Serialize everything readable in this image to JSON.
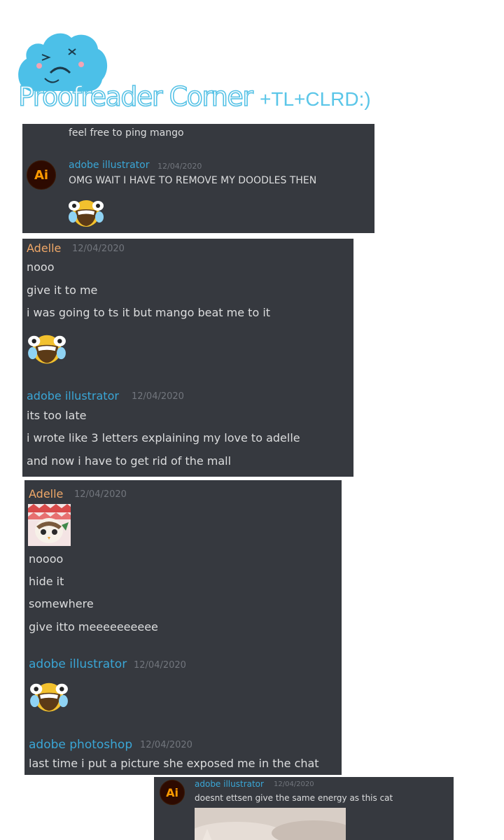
{
  "header": {
    "title": "Proofreader Corner",
    "tag": "+TL+CLRD:)"
  },
  "panel1": {
    "prev_message": "feel free to ping mango",
    "avatar_text": "Ai",
    "author": "adobe illustrator",
    "timestamp": "12/04/2020",
    "message": "OMG WAIT I HAVE TO REMOVE MY DOODLES THEN"
  },
  "panel2": {
    "author1": "Adelle",
    "timestamp1": "12/04/2020",
    "messages1": [
      "nooo",
      "give it to me",
      "i was going to ts it but mango beat me to it"
    ],
    "author2": "adobe illustrator",
    "timestamp2": "12/04/2020",
    "messages2": [
      "its too late",
      "i wrote like 3 letters explaining my love to adelle",
      "and now i have to get rid of the mall"
    ]
  },
  "panel3": {
    "author1": "Adelle",
    "timestamp1": "12/04/2020",
    "messages1": [
      "noooo",
      "hide it",
      "somewhere",
      "give itto meeeeeeeeee"
    ],
    "author2": "adobe illustrator",
    "timestamp2": "12/04/2020",
    "author3": "adobe photoshop",
    "timestamp3": "12/04/2020",
    "message3": "last time i put a picture she exposed me in the chat"
  },
  "panel4": {
    "avatar_text": "Ai",
    "author": "adobe illustrator",
    "timestamp": "12/04/2020",
    "message": "doesnt ettsen give the same energy as this cat"
  },
  "colors": {
    "panel_bg": "#36393f",
    "text": "#dcddde",
    "timestamp": "#72767d",
    "username_adelle": "#f0a868",
    "username_ai": "#3aa6d6",
    "title_outline": "#56c2e6",
    "ai_logo_bg": "#2d0a00",
    "ai_logo_text": "#ff9a00"
  },
  "icons": [
    "cloud-mascot-icon",
    "adobe-illustrator-logo-icon",
    "laughing-crying-emoji-icon",
    "profile-picture-icon",
    "cat-photo-icon"
  ]
}
